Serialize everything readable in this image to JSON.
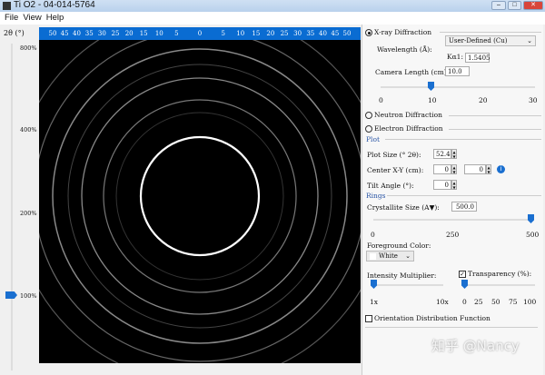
{
  "window": {
    "title": "Ti O2 - 04-014-5764",
    "minimize": "–",
    "maximize": "□",
    "close": "✕"
  },
  "menu": [
    "File",
    "View",
    "Help"
  ],
  "ruler": {
    "label": "2θ (°)",
    "ticks": [
      "50",
      "45",
      "40",
      "35",
      "30",
      "25",
      "20",
      "15",
      "10",
      "5",
      "0",
      "5",
      "10",
      "15",
      "20",
      "25",
      "30",
      "35",
      "40",
      "45",
      "50"
    ]
  },
  "zoom_slider": {
    "labels": [
      "800%",
      "400%",
      "200%",
      "100%"
    ],
    "value": "100%"
  },
  "xray": {
    "label": "X-ray Diffraction",
    "selected": true,
    "wavelength_label": "Wavelength (Å):",
    "wavelength_select": "User-Defined (Cu)",
    "ka_label": "Kα1:",
    "ka_value": "1.5405",
    "camera_label": "Camera Length (cm):",
    "camera_value": "10.0",
    "camera_ticks": [
      "0",
      "10",
      "20",
      "30"
    ],
    "camera_fraction": 0.333
  },
  "neutron": {
    "label": "Neutron Diffraction"
  },
  "electron": {
    "label": "Electron Diffraction"
  },
  "plot": {
    "section": "Plot",
    "size_label": "Plot Size (° 2θ):",
    "size_value": "52.4",
    "center_label": "Center X-Y (cm):",
    "center_x": "0",
    "center_y": "0",
    "tilt_label": "Tilt Angle (°):",
    "tilt_value": "0"
  },
  "rings": {
    "section": "Rings",
    "cryst_label": "Crystallite Size (A▼):",
    "cryst_value": "500.0",
    "cryst_ticks": [
      "0",
      "250",
      "500"
    ],
    "cryst_fraction": 1.0,
    "fg_label": "Foreground Color:",
    "fg_value": "White",
    "intensity_label": "Intensity Multiplier:",
    "intensity_ticks": [
      "1x",
      "10x"
    ],
    "intensity_fraction": 0,
    "transparency_label": "Transparency (%):",
    "transparency_checked": true,
    "transparency_ticks": [
      "0",
      "25",
      "50",
      "75",
      "100"
    ],
    "transparency_fraction": 0,
    "odf_label": "Orientation Distribution Function"
  },
  "watermark": "知乎 @Nancy"
}
